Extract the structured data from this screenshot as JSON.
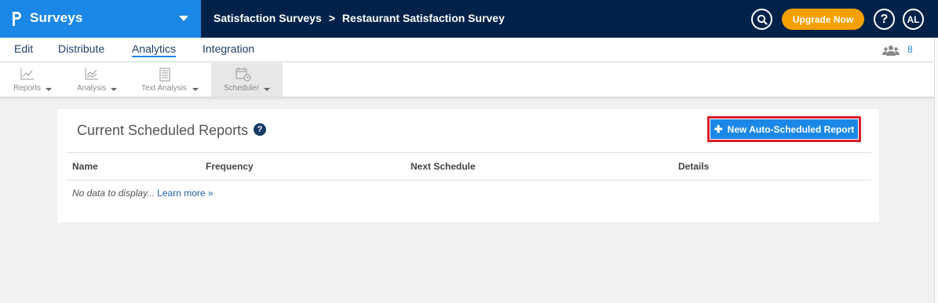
{
  "header": {
    "app_title": "Surveys",
    "breadcrumb": [
      "Satisfaction Surveys",
      "Restaurant Satisfaction Survey"
    ],
    "breadcrumb_separator": ">",
    "upgrade_label": "Upgrade Now",
    "help_label": "?",
    "avatar_initials": "AL",
    "colors": {
      "brand": "#1b87e6",
      "nav_bg": "#002249",
      "upgrade": "#f5a000"
    }
  },
  "nav": {
    "tabs": [
      {
        "label": "Edit",
        "active": false
      },
      {
        "label": "Distribute",
        "active": false
      },
      {
        "label": "Analytics",
        "active": true
      },
      {
        "label": "Integration",
        "active": false
      }
    ],
    "user_count": "8",
    "user_icon": "users-icon"
  },
  "subnav": {
    "tools": [
      {
        "label": "Reports",
        "icon": "line-chart-icon",
        "active": false
      },
      {
        "label": "Analysis",
        "icon": "analysis-chart-icon",
        "active": false
      },
      {
        "label": "Text Analysis",
        "icon": "text-analysis-icon",
        "active": false
      },
      {
        "label": "Scheduler",
        "icon": "calendar-clock-icon",
        "active": true
      }
    ]
  },
  "card": {
    "title": "Current Scheduled Reports",
    "new_button_label": "New Auto-Scheduled Report",
    "columns": [
      "Name",
      "Frequency",
      "Next Schedule",
      "Details"
    ],
    "empty_text": "No data to display...",
    "learn_more": "Learn more »",
    "highlight_color": "#d81f2a"
  }
}
